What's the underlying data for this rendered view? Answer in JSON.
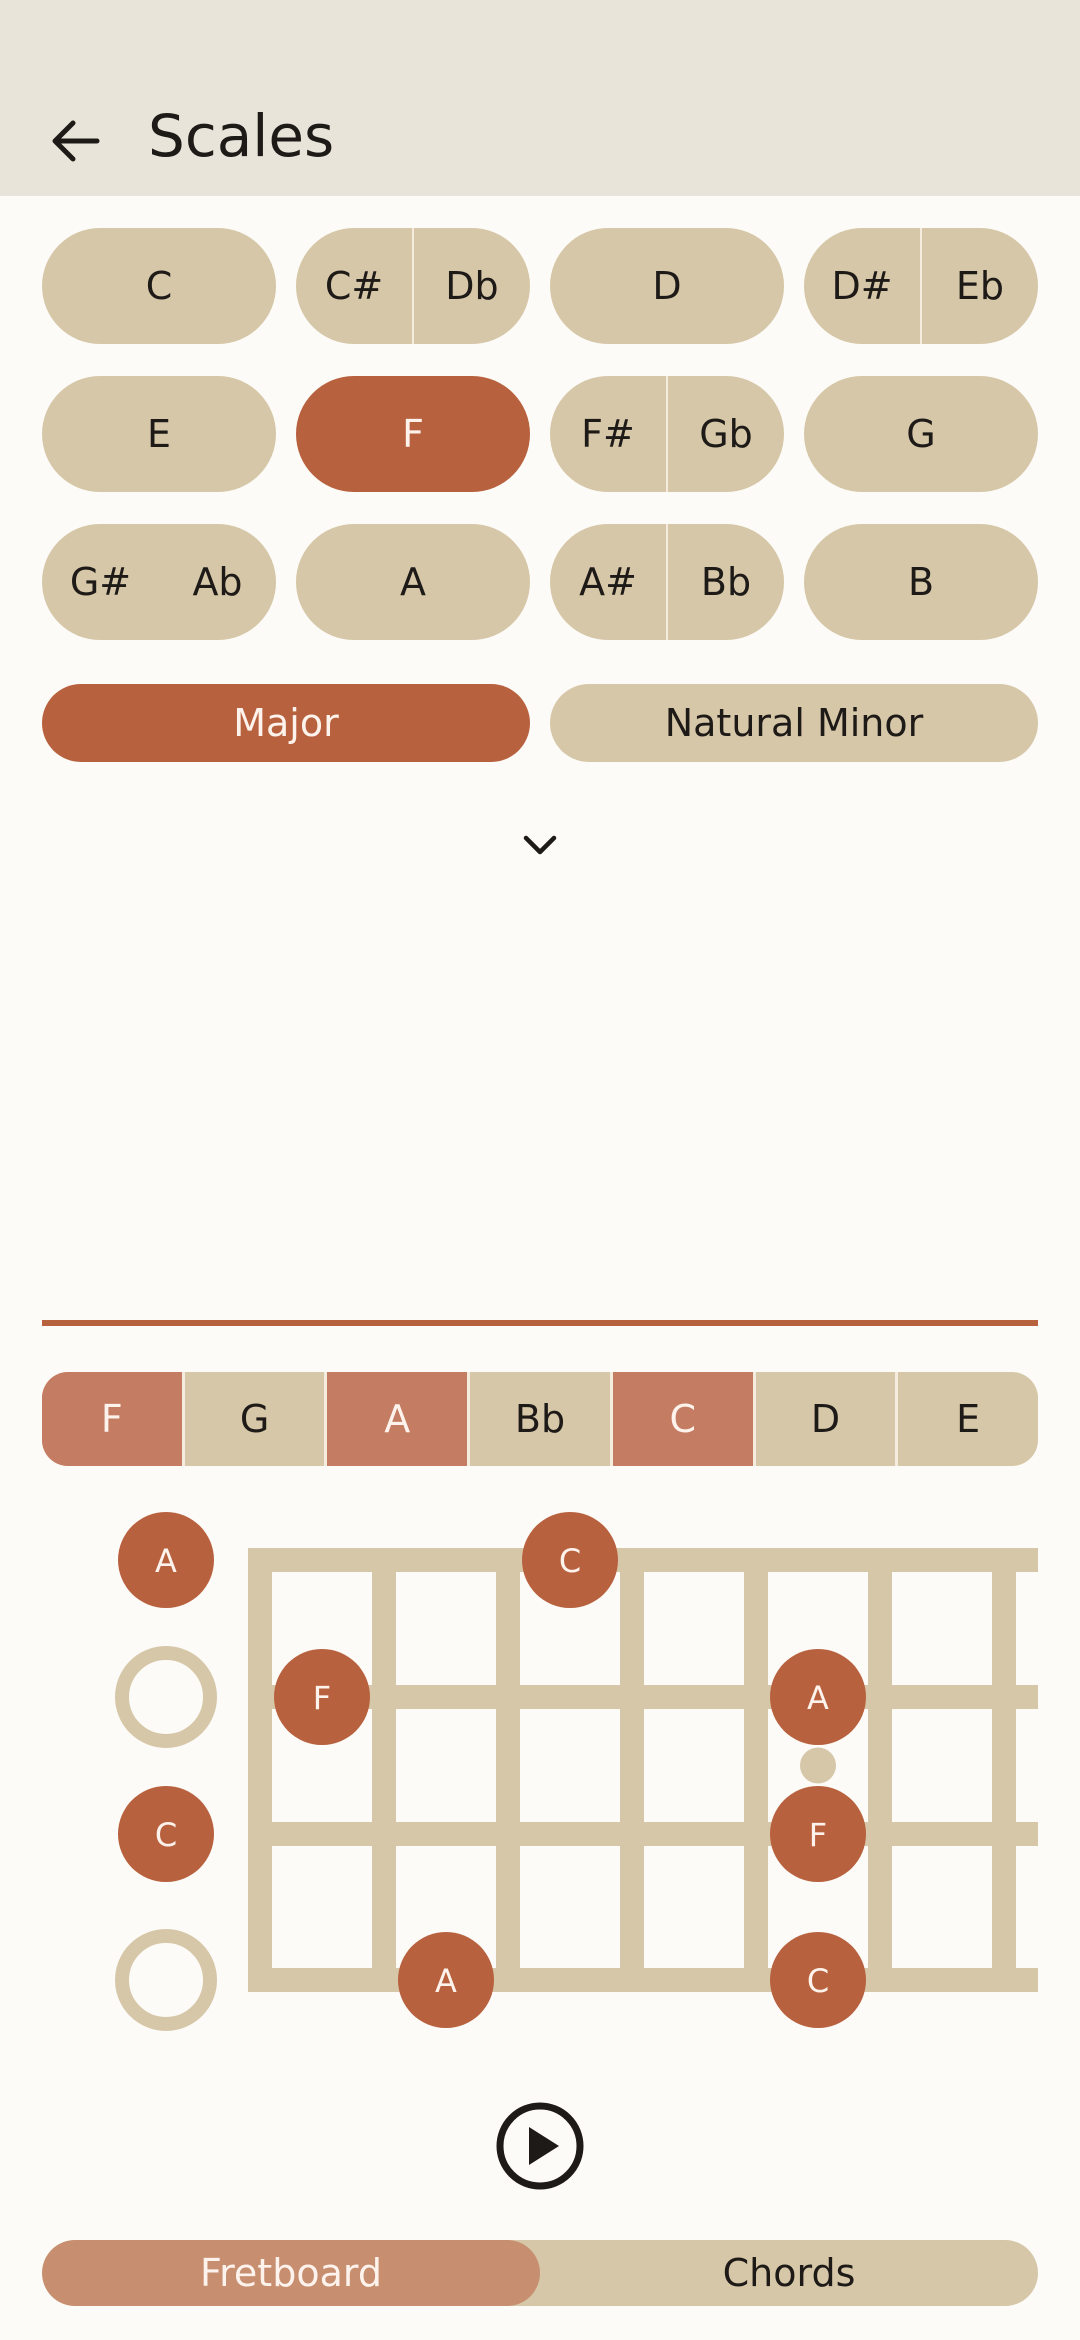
{
  "appbar": {
    "title": "Scales"
  },
  "keys": [
    {
      "single": "C"
    },
    {
      "left": "C#",
      "right": "Db"
    },
    {
      "single": "D"
    },
    {
      "left": "D#",
      "right": "Eb"
    },
    {
      "single": "E"
    },
    {
      "single": "F",
      "selected": true
    },
    {
      "left": "F#",
      "right": "Gb"
    },
    {
      "single": "G"
    },
    {
      "left": "G#",
      "right": "Ab"
    },
    {
      "single": "A"
    },
    {
      "left": "A#",
      "right": "Bb"
    },
    {
      "single": "B"
    }
  ],
  "modes": {
    "major": "Major",
    "natural_minor": "Natural Minor",
    "selected": "major"
  },
  "scale_notes": [
    "F",
    "G",
    "A",
    "Bb",
    "C",
    "D",
    "E"
  ],
  "chord_tones": [
    "F",
    "A",
    "C"
  ],
  "fretboard": {
    "open_strings": [
      "A",
      "",
      "C",
      ""
    ],
    "markers": [
      {
        "string": 0,
        "fret": 3,
        "note": "C"
      },
      {
        "string": 1,
        "fret": 1,
        "note": "F"
      },
      {
        "string": 1,
        "fret": 5,
        "note": "A"
      },
      {
        "string": 2,
        "fret": 5,
        "note": "F"
      },
      {
        "string": 3,
        "fret": 2,
        "note": "A"
      },
      {
        "string": 3,
        "fret": 5,
        "note": "C"
      }
    ],
    "inlay_frets": [
      5
    ]
  },
  "colors": {
    "accent": "#b8613e",
    "beige": "#d6c7a8",
    "background": "#fdfbf7",
    "appbar": "#e9e4d9"
  },
  "tabs": {
    "fretboard": "Fretboard",
    "chords": "Chords",
    "active": "fretboard"
  },
  "icons": {
    "back": "arrow-left-icon",
    "expand": "chevron-down-icon",
    "play": "play-circle-icon"
  }
}
